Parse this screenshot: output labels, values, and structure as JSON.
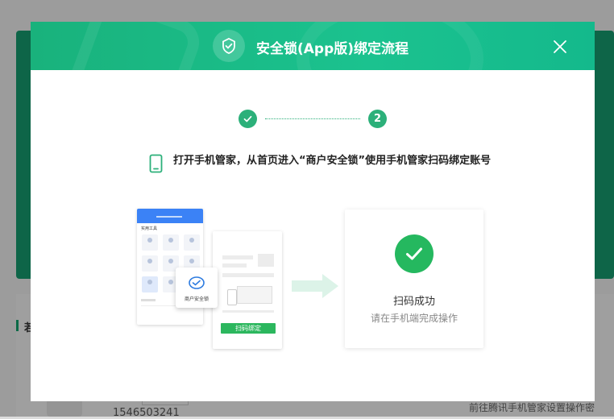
{
  "background": {
    "section_title": "若",
    "bottom_number": "1546503241",
    "bottom_right_text": "前往腾讯手机管家设置操作密"
  },
  "modal": {
    "title": "安全锁(App版)绑定流程",
    "close_icon": "close-icon",
    "steps": {
      "step1_icon": "check-icon",
      "step2_number": "2"
    },
    "instruction": "打开手机管家，从首页进入“商户安全锁”使用手机管家扫码绑定账号",
    "illustration": {
      "app_label": "实用工具",
      "popup_label": "商户安全锁",
      "doc_button": "扫码绑定"
    },
    "success": {
      "title": "扫码成功",
      "subtitle": "请在手机端完成操作"
    }
  },
  "colors": {
    "accent": "#2cb07a",
    "header_start": "#19b27c",
    "success_green": "#25b85f"
  }
}
